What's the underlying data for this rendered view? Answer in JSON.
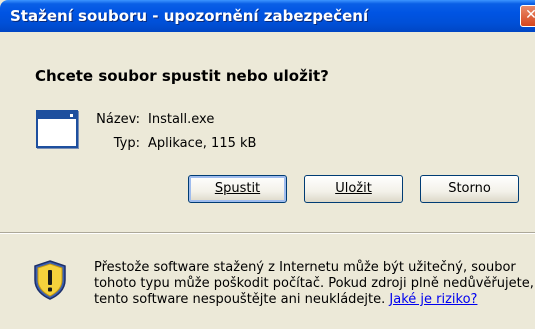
{
  "window": {
    "title": "Stažení souboru - upozornění zabezpečení",
    "close_glyph": "✕"
  },
  "dialog": {
    "question": "Chcete soubor spustit nebo uložit?",
    "file": {
      "name_label": "Název:",
      "name_value": "Install.exe",
      "type_label": "Typ:",
      "type_value": "Aplikace, 115 kB",
      "icon": "application-window-icon"
    },
    "buttons": {
      "run": "Spustit",
      "save": "Uložit",
      "cancel": "Storno"
    }
  },
  "warning": {
    "icon": "security-shield-icon",
    "line1": "Přestože software stažený z Internetu může být užitečný, soubor",
    "line2": "tohoto typu může poškodit počítač. Pokud zdroji plně nedůvěřujete,",
    "line3_text": "tento software nespouštějte ani neukládejte.",
    "link": "Jaké je riziko?"
  },
  "colors": {
    "titlebar": "#0054e3",
    "dialog_bg": "#ece9d8",
    "link": "#0000ee"
  }
}
